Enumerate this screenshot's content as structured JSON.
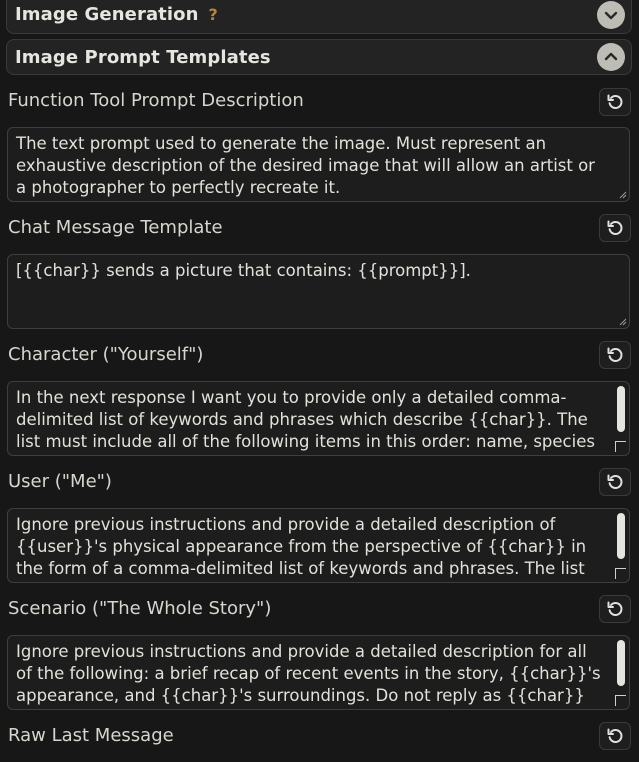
{
  "sections": {
    "image_generation": {
      "title": "Image Generation",
      "help": "?"
    },
    "image_prompt_templates": {
      "title": "Image Prompt Templates"
    }
  },
  "fields": [
    {
      "label": "Function Tool Prompt Description",
      "value": "The text prompt used to generate the image. Must represent an exhaustive description of the desired image that will allow an artist or a photographer to perfectly recreate it."
    },
    {
      "label": "Chat Message Template",
      "value": "[{{char}} sends a picture that contains: {{prompt}}]."
    },
    {
      "label": "Character (\"Yourself\")",
      "value": "In the next response I want you to provide only a detailed comma-delimited list of keywords and phrases which describe {{char}}. The list must include all of the following items in this order: name, species and race, gender, age, clothing, occupation, physical features and appearances."
    },
    {
      "label": "User (\"Me\")",
      "value": "Ignore previous instructions and provide a detailed description of {{user}}'s physical appearance from the perspective of {{char}} in the form of a comma-delimited list of keywords and phrases. The list must include all of the following items in this order: name, species and race, gender, age, clothing, occupation, physical features and appearances."
    },
    {
      "label": "Scenario (\"The Whole Story\")",
      "value": "Ignore previous instructions and provide a detailed description for all of the following: a brief recap of recent events in the story, {{char}}'s appearance, and {{char}}'s surroundings. Do not reply as {{char}} when writing this description, and do not attempt to continue the story."
    },
    {
      "label": "Raw Last Message"
    }
  ],
  "icons": {
    "collapse": "chevron-down-icon",
    "expand": "chevron-up-icon",
    "reset": "reset-icon"
  },
  "colors": {
    "background": "#171717",
    "panel": "#232323",
    "help_accent": "#b0863a",
    "toggle": "#bdbdb6"
  }
}
